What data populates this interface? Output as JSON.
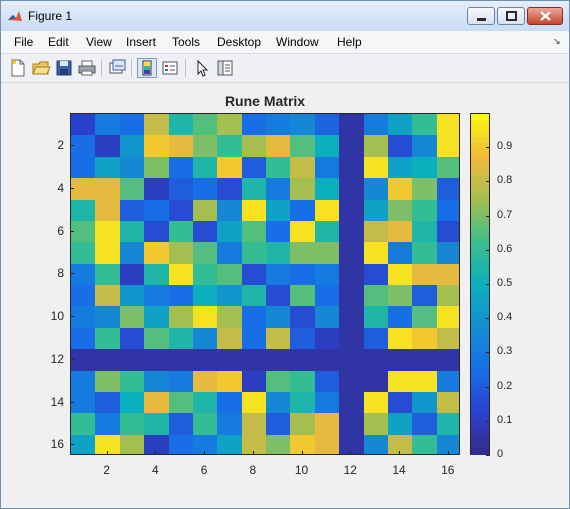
{
  "window": {
    "title": "Figure 1"
  },
  "menu": {
    "items": [
      "File",
      "Edit",
      "View",
      "Insert",
      "Tools",
      "Desktop",
      "Window",
      "Help"
    ]
  },
  "toolbar": {
    "icons": [
      "new-figure-icon",
      "open-file-icon",
      "save-icon",
      "print-icon",
      "link-plot-icon",
      "insert-colorbar-icon",
      "insert-legend-icon",
      "edit-plot-icon",
      "property-inspector-icon"
    ]
  },
  "chart_data": {
    "type": "heatmap",
    "title": "Rune Matrix",
    "x_ticks": [
      "2",
      "4",
      "6",
      "8",
      "10",
      "12",
      "14",
      "16"
    ],
    "y_ticks": [
      "2",
      "4",
      "6",
      "8",
      "10",
      "12",
      "14",
      "16"
    ],
    "colorbar_ticks": [
      "0",
      "0.1",
      "0.2",
      "0.3",
      "0.4",
      "0.5",
      "0.6",
      "0.7",
      "0.8",
      "0.9"
    ],
    "clim": [
      0,
      1
    ],
    "colormap": "parula",
    "matrix": [
      [
        0.12,
        0.3,
        0.25,
        0.8,
        0.55,
        0.65,
        0.75,
        0.25,
        0.3,
        0.35,
        0.22,
        0.05,
        0.3,
        0.45,
        0.6,
        0.95
      ],
      [
        0.25,
        0.1,
        0.4,
        0.9,
        0.85,
        0.7,
        0.6,
        0.75,
        0.85,
        0.65,
        0.5,
        0.05,
        0.75,
        0.15,
        0.35,
        0.95
      ],
      [
        0.25,
        0.45,
        0.35,
        0.7,
        0.25,
        0.55,
        0.9,
        0.2,
        0.6,
        0.8,
        0.3,
        0.05,
        0.95,
        0.45,
        0.5,
        0.65
      ],
      [
        0.85,
        0.85,
        0.65,
        0.1,
        0.2,
        0.25,
        0.15,
        0.55,
        0.3,
        0.75,
        0.5,
        0.05,
        0.35,
        0.9,
        0.7,
        0.2
      ],
      [
        0.55,
        0.85,
        0.2,
        0.25,
        0.15,
        0.75,
        0.35,
        0.95,
        0.45,
        0.25,
        0.95,
        0.05,
        0.45,
        0.7,
        0.6,
        0.25
      ],
      [
        0.65,
        0.95,
        0.55,
        0.15,
        0.6,
        0.15,
        0.45,
        0.65,
        0.25,
        0.95,
        0.55,
        0.05,
        0.8,
        0.85,
        0.55,
        0.15
      ],
      [
        0.6,
        0.95,
        0.35,
        0.9,
        0.75,
        0.65,
        0.3,
        0.6,
        0.55,
        0.7,
        0.7,
        0.05,
        0.95,
        0.3,
        0.6,
        0.35
      ],
      [
        0.3,
        0.6,
        0.1,
        0.55,
        0.95,
        0.6,
        0.65,
        0.15,
        0.3,
        0.25,
        0.3,
        0.05,
        0.15,
        0.95,
        0.85,
        0.85
      ],
      [
        0.25,
        0.8,
        0.4,
        0.3,
        0.25,
        0.5,
        0.4,
        0.55,
        0.15,
        0.65,
        0.25,
        0.05,
        0.65,
        0.7,
        0.2,
        0.75
      ],
      [
        0.3,
        0.35,
        0.7,
        0.45,
        0.75,
        0.95,
        0.75,
        0.25,
        0.35,
        0.15,
        0.35,
        0.05,
        0.55,
        0.25,
        0.65,
        0.95
      ],
      [
        0.25,
        0.6,
        0.15,
        0.65,
        0.55,
        0.35,
        0.8,
        0.25,
        0.8,
        0.2,
        0.1,
        0.05,
        0.2,
        0.95,
        0.9,
        0.8
      ],
      [
        0.05,
        0.05,
        0.05,
        0.05,
        0.05,
        0.05,
        0.05,
        0.05,
        0.05,
        0.05,
        0.05,
        0.05,
        0.05,
        0.05,
        0.05,
        0.05
      ],
      [
        0.3,
        0.7,
        0.6,
        0.35,
        0.3,
        0.85,
        0.9,
        0.1,
        0.65,
        0.6,
        0.2,
        0.05,
        0.05,
        0.95,
        0.95,
        0.3
      ],
      [
        0.3,
        0.2,
        0.5,
        0.85,
        0.65,
        0.55,
        0.25,
        0.95,
        0.35,
        0.55,
        0.3,
        0.05,
        0.95,
        0.15,
        0.4,
        0.8
      ],
      [
        0.6,
        0.3,
        0.6,
        0.55,
        0.2,
        0.6,
        0.3,
        0.8,
        0.2,
        0.75,
        0.85,
        0.05,
        0.75,
        0.45,
        0.2,
        0.55
      ],
      [
        0.45,
        0.95,
        0.75,
        0.1,
        0.25,
        0.3,
        0.45,
        0.8,
        0.7,
        0.9,
        0.85,
        0.05,
        0.35,
        0.8,
        0.6,
        0.35
      ]
    ]
  }
}
